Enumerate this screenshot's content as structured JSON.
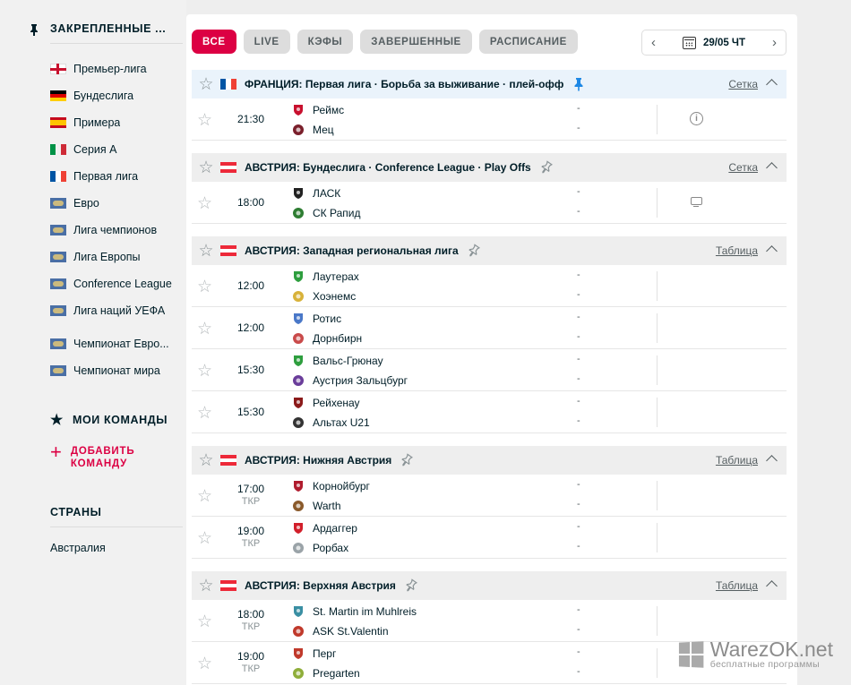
{
  "sidebar": {
    "pinned_title": "ЗАКРЕПЛЕННЫЕ ...",
    "items": [
      {
        "label": "Премьер-лига",
        "flag": "england"
      },
      {
        "label": "Бундеслига",
        "flag": "germany"
      },
      {
        "label": "Примера",
        "flag": "spain"
      },
      {
        "label": "Серия А",
        "flag": "italy"
      },
      {
        "label": "Первая лига",
        "flag": "france"
      },
      {
        "label": "Евро",
        "flag": "world"
      },
      {
        "label": "Лига чемпионов",
        "flag": "world"
      },
      {
        "label": "Лига Европы",
        "flag": "world"
      },
      {
        "label": "Conference League",
        "flag": "world"
      },
      {
        "label": "Лига наций УЕФА",
        "flag": "world"
      },
      {
        "label": "Чемпионат Евро...",
        "flag": "world"
      },
      {
        "label": "Чемпионат мира",
        "flag": "world"
      }
    ],
    "my_teams_title": "МОИ КОМАНДЫ",
    "add_team_line1": "ДОБАВИТЬ",
    "add_team_line2": "КОМАНДУ",
    "countries_title": "СТРАНЫ",
    "countries": [
      "Австралия"
    ]
  },
  "filters": [
    "ВСЕ",
    "LIVE",
    "КЭФЫ",
    "ЗАВЕРШЕННЫЕ",
    "РАСПИСАНИЕ"
  ],
  "date": "29/05 ЧТ",
  "leagues": [
    {
      "title": "ФРАНЦИЯ: Первая лига · Борьба за выживание · плей-офф",
      "flag": "france",
      "pinned": true,
      "link": "Сетка",
      "matches": [
        {
          "time": "21:30",
          "sub": "",
          "home": "Реймс",
          "away": "Мец",
          "home_logo": "#c8102e",
          "away_logo": "#7a1f2b",
          "home_score": "-",
          "away_score": "-",
          "icon": "info-icon"
        }
      ]
    },
    {
      "title": "АВСТРИЯ: Бундеслига · Conference League · Play Offs",
      "flag": "austria",
      "pinned": false,
      "link": "Сетка",
      "matches": [
        {
          "time": "18:00",
          "sub": "",
          "home": "ЛАСК",
          "away": "СК Рапид",
          "home_logo": "#222222",
          "away_logo": "#2e7d32",
          "home_score": "-",
          "away_score": "-",
          "icon": "tv-icon"
        }
      ]
    },
    {
      "title": "АВСТРИЯ: Западная региональная лига",
      "flag": "austria",
      "pinned": false,
      "link": "Таблица",
      "matches": [
        {
          "time": "12:00",
          "sub": "",
          "home": "Лаутерах",
          "away": "Хоэнемс",
          "home_logo": "#2e9e3e",
          "away_logo": "#d8b23a",
          "home_score": "-",
          "away_score": "-",
          "icon": ""
        },
        {
          "time": "12:00",
          "sub": "",
          "home": "Ротис",
          "away": "Дорнбирн",
          "home_logo": "#4a78c8",
          "away_logo": "#c94a4a",
          "home_score": "-",
          "away_score": "-",
          "icon": ""
        },
        {
          "time": "15:30",
          "sub": "",
          "home": "Вальс-Грюнау",
          "away": "Аустрия Зальцбург",
          "home_logo": "#2e9e3e",
          "away_logo": "#6a3d9a",
          "home_score": "-",
          "away_score": "-",
          "icon": ""
        },
        {
          "time": "15:30",
          "sub": "",
          "home": "Рейхенау",
          "away": "Альтах U21",
          "home_logo": "#8b1a1a",
          "away_logo": "#333333",
          "home_score": "-",
          "away_score": "-",
          "icon": ""
        }
      ]
    },
    {
      "title": "АВСТРИЯ: Нижняя Австрия",
      "flag": "austria",
      "pinned": false,
      "link": "Таблица",
      "matches": [
        {
          "time": "17:00",
          "sub": "ТКР",
          "home": "Корнойбург",
          "away": "Warth",
          "home_logo": "#b01c2e",
          "away_logo": "#8a5a2b",
          "home_score": "-",
          "away_score": "-",
          "icon": ""
        },
        {
          "time": "19:00",
          "sub": "ТКР",
          "home": "Ардаггер",
          "away": "Рорбах",
          "home_logo": "#d21f2b",
          "away_logo": "#9aa3a8",
          "home_score": "-",
          "away_score": "-",
          "icon": ""
        }
      ]
    },
    {
      "title": "АВСТРИЯ: Верхняя Австрия",
      "flag": "austria",
      "pinned": false,
      "link": "Таблица",
      "matches": [
        {
          "time": "18:00",
          "sub": "ТКР",
          "home": "St. Martin im Muhlreis",
          "away": "ASK St.Valentin",
          "home_logo": "#3a8fa3",
          "away_logo": "#c0392b",
          "home_score": "-",
          "away_score": "-",
          "icon": ""
        },
        {
          "time": "19:00",
          "sub": "ТКР",
          "home": "Перг",
          "away": "Pregarten",
          "home_logo": "#c0392b",
          "away_logo": "#8fae3a",
          "home_score": "-",
          "away_score": "-",
          "icon": ""
        }
      ]
    }
  ],
  "watermark": {
    "title": "WarezOK.net",
    "subtitle": "бесплатные программы"
  },
  "colors": {
    "accent": "#dc0043",
    "text": "#001e28",
    "muted": "#555e61"
  }
}
